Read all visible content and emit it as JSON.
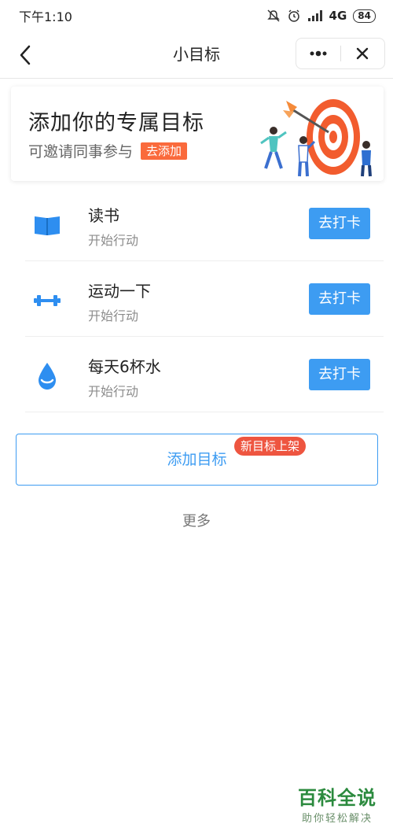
{
  "status_bar": {
    "time": "下午1:10",
    "network": "4G",
    "battery": "84"
  },
  "nav": {
    "title": "小目标"
  },
  "banner": {
    "title": "添加你的专属目标",
    "subtitle": "可邀请同事参与",
    "tag": "去添加"
  },
  "goals": [
    {
      "icon": "book-icon",
      "name": "读书",
      "status": "开始行动",
      "button": "去打卡"
    },
    {
      "icon": "dumbbell-icon",
      "name": "运动一下",
      "status": "开始行动",
      "button": "去打卡"
    },
    {
      "icon": "water-drop-icon",
      "name": "每天6杯水",
      "status": "开始行动",
      "button": "去打卡"
    }
  ],
  "add_goal": {
    "label": "添加目标",
    "badge": "新目标上架"
  },
  "more": "更多",
  "watermark": {
    "main": "百科全说",
    "sub": "助你轻松解决"
  },
  "colors": {
    "primary": "#3d9cf2",
    "tag_orange": "#fa6a3c",
    "badge_red": "#ee5540"
  }
}
